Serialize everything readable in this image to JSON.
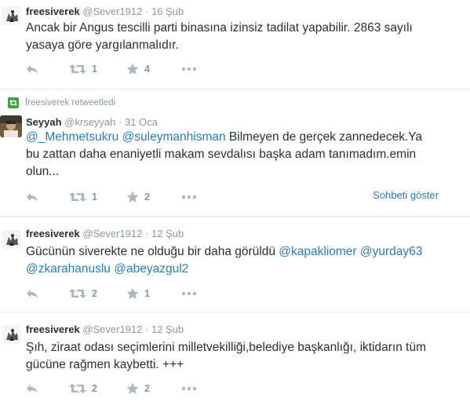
{
  "tweets": [
    {
      "fullname": "freesiverek",
      "username": "@Sever1912",
      "separator": "·",
      "time": "16 Şub",
      "text": "Ancak bir Angus tescilli parti binasına izinsiz tadilat yapabilir. 2863 sayılı\nyasaya göre yargılanmalıdır.",
      "retweets": "1",
      "favorites": "4"
    },
    {
      "retweet_context": "freesiverek retweetledi",
      "fullname": "Seyyah",
      "username": "@krseyyah",
      "separator": "·",
      "time": "31 Oca",
      "mention1": "@_Mehmetsukru",
      "mention2": "@suleymanhisman",
      "text_line1": " Bilmeyen de gerçek zannedecek.Ya",
      "text_rest": "bu zattan daha enaniyetli makam sevdalısı başka adam tanımadım.emin\nolun...",
      "retweets": "1",
      "favorites": "2",
      "conversation_link": "Sohbeti göster"
    },
    {
      "fullname": "freesiverek",
      "username": "@Sever1912",
      "separator": "·",
      "time": "12 Şub",
      "text_start": "Gücünün siverekte ne olduğu bir daha görüldü ",
      "mention1": "@kapakliomer",
      "mention2": "@yurday63",
      "mention3": "@zkarahanuslu",
      "mention4": "@abeyazgul2",
      "retweets": "2",
      "favorites": "1"
    },
    {
      "fullname": "freesiverek",
      "username": "@Sever1912",
      "separator": "·",
      "time": "12 Şub",
      "text": "Şıh, ziraat odası seçimlerini milletvekilliği,belediye başkanlığı, iktidarın tüm\ngücüne rağmen kaybetti. +++",
      "retweets": "2",
      "favorites": "2"
    }
  ],
  "icons": {
    "reply": "reply-icon",
    "retweet": "retweet-icon",
    "favorite": "star-icon",
    "more": "more-icon"
  },
  "colors": {
    "link": "#2b7bb9",
    "muted": "#8899a6",
    "icon": "#aab8c2",
    "retweet_badge": "#3fa33f"
  }
}
